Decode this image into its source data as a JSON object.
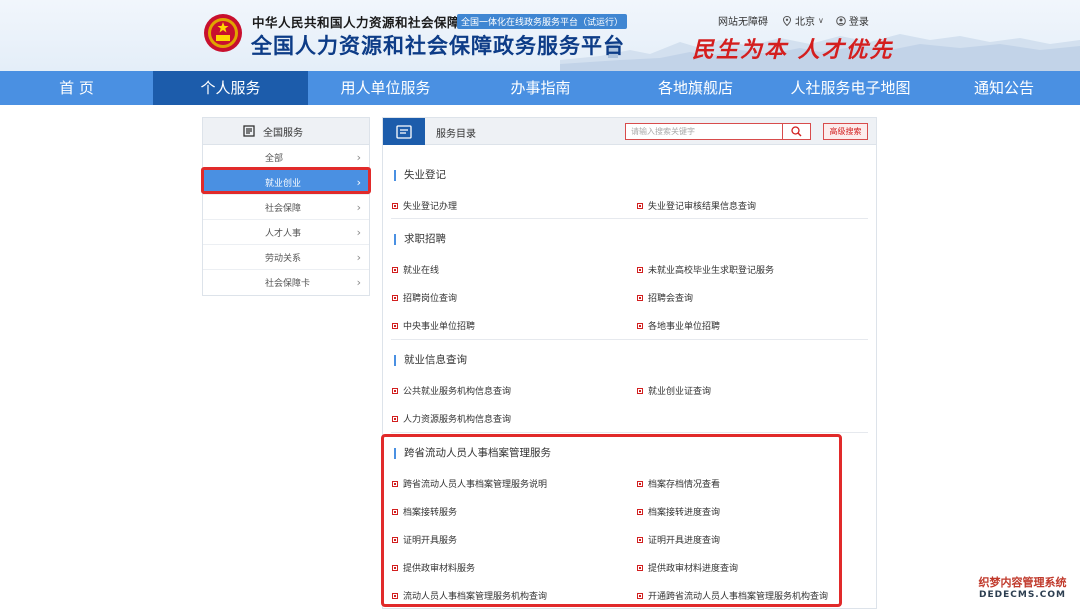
{
  "header": {
    "org_name": "中华人民共和国人力资源和社会保障部",
    "org_badge": "全国一体化在线政务服务平台（试运行）",
    "site_title": "全国人力资源和社会保障政务服务平台",
    "slogan": "民生为本 人才优先",
    "accessibility": "网站无障碍",
    "location": "北京",
    "login": "登录"
  },
  "nav": {
    "items": [
      {
        "label": "首 页"
      },
      {
        "label": "个人服务"
      },
      {
        "label": "用人单位服务"
      },
      {
        "label": "办事指南"
      },
      {
        "label": "各地旗舰店"
      },
      {
        "label": "人社服务电子地图"
      },
      {
        "label": "通知公告"
      }
    ],
    "active": "个人服务"
  },
  "sidebar": {
    "title": "全国服务",
    "items": [
      {
        "label": "全部"
      },
      {
        "label": "就业创业"
      },
      {
        "label": "社会保障"
      },
      {
        "label": "人才人事"
      },
      {
        "label": "劳动关系"
      },
      {
        "label": "社会保障卡"
      }
    ],
    "active": "就业创业"
  },
  "main": {
    "title": "服务目录",
    "search_placeholder": "请输入搜索关键字",
    "advanced_search": "高级搜索",
    "sections": [
      {
        "title": "失业登记",
        "items": [
          "失业登记办理",
          "失业登记审核结果信息查询"
        ]
      },
      {
        "title": "求职招聘",
        "items": [
          "就业在线",
          "未就业高校毕业生求职登记服务",
          "招聘岗位查询",
          "招聘会查询",
          "中央事业单位招聘",
          "各地事业单位招聘"
        ]
      },
      {
        "title": "就业信息查询",
        "items": [
          "公共就业服务机构信息查询",
          "就业创业证查询",
          "人力资源服务机构信息查询"
        ]
      },
      {
        "title": "跨省流动人员人事档案管理服务",
        "items": [
          "跨省流动人员人事档案管理服务说明",
          "档案存档情况查看",
          "档案接转服务",
          "档案接转进度查询",
          "证明开具服务",
          "证明开具进度查询",
          "提供政审材料服务",
          "提供政审材料进度查询",
          "流动人员人事档案管理服务机构查询",
          "开通跨省流动人员人事档案管理服务机构查询"
        ]
      }
    ]
  },
  "watermark": {
    "line1": "织梦内容管理系统",
    "line2": "DEDECMS.COM"
  }
}
